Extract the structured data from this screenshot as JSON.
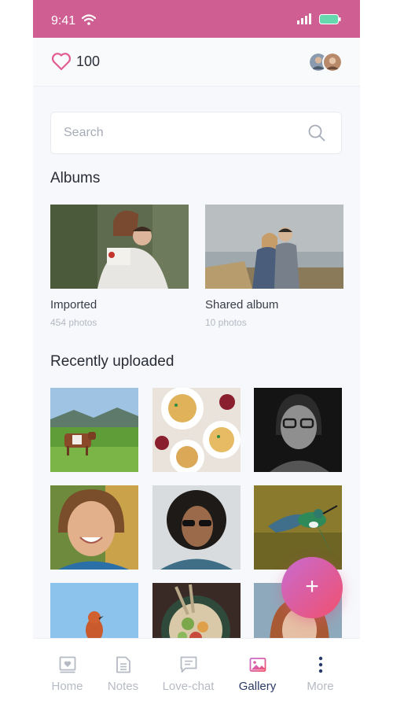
{
  "status_bar": {
    "time": "9:41",
    "color": "#cf5f93"
  },
  "header": {
    "likes_count": "100",
    "heart_color": "#e25c92"
  },
  "search": {
    "placeholder": "Search"
  },
  "albums": {
    "title": "Albums",
    "items": [
      {
        "name": "Imported",
        "count": "454 photos"
      },
      {
        "name": "Shared album",
        "count": "10 photos"
      }
    ]
  },
  "recent": {
    "title": "Recently uploaded",
    "photos": [
      "cow-in-field",
      "pasta-dishes",
      "man-with-glasses-bw",
      "smiling-woman",
      "man-with-sunglasses",
      "hummingbird",
      "bird-on-branch",
      "salad-bowl",
      "woman-portrait"
    ]
  },
  "fab": {
    "label": "+"
  },
  "tab_bar": {
    "items": [
      {
        "label": "Home",
        "icon": "home-icon"
      },
      {
        "label": "Notes",
        "icon": "notes-icon"
      },
      {
        "label": "Love-chat",
        "icon": "chat-icon"
      },
      {
        "label": "Gallery",
        "icon": "gallery-icon",
        "active": true
      },
      {
        "label": "More",
        "icon": "more-icon"
      }
    ],
    "active_color": "#2a3a66",
    "inactive_color": "#b6bac4"
  }
}
